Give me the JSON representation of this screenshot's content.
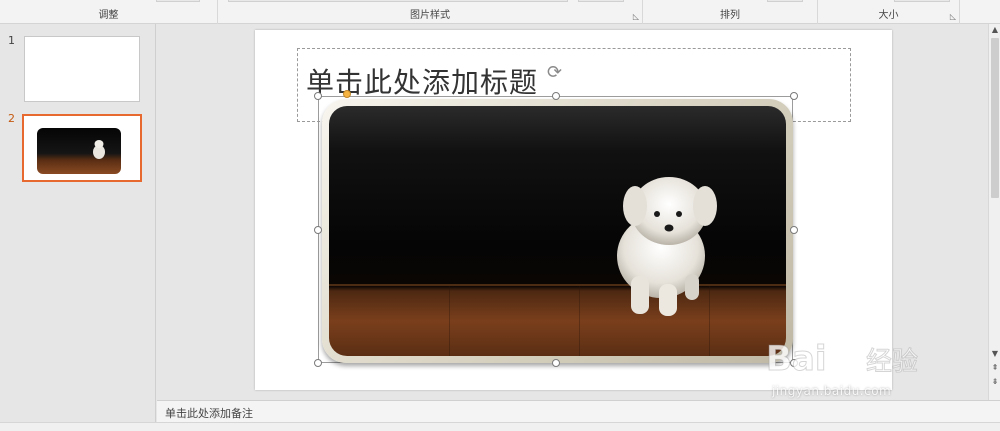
{
  "ribbon": {
    "groups": [
      {
        "label": "调整"
      },
      {
        "label": "图片样式"
      },
      {
        "label": "排列"
      },
      {
        "label": "大小"
      }
    ]
  },
  "thumbnails": [
    {
      "number": "1"
    },
    {
      "number": "2"
    }
  ],
  "slide": {
    "title_placeholder": "单击此处添加标题"
  },
  "notes": {
    "placeholder": "单击此处添加备注"
  },
  "watermark": {
    "logo_text": "Bai du 经验",
    "url": "jingyan.baidu.com"
  },
  "colors": {
    "accent": "#e8692f",
    "selection_handle": "#f5b342"
  }
}
